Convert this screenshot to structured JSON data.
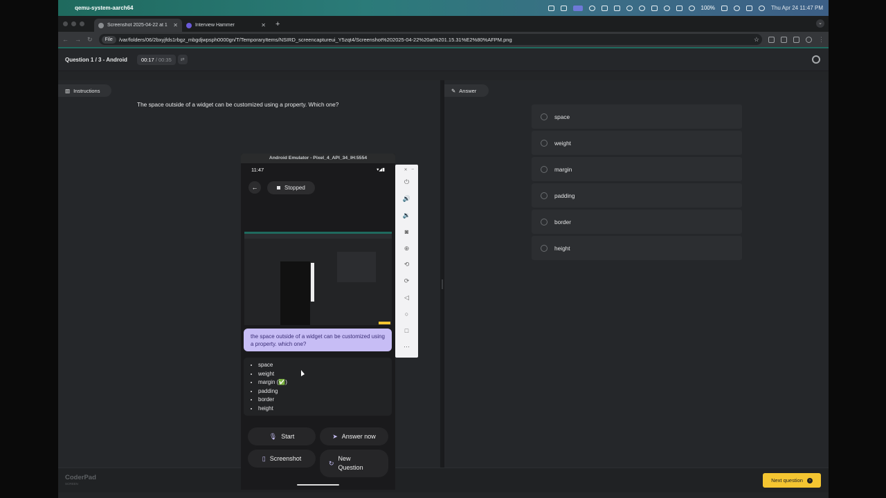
{
  "menubar": {
    "app_name": "qemu-system-aarch64",
    "battery": "100%",
    "clock": "Thu Apr 24  11:47 PM"
  },
  "browser": {
    "tabs": [
      {
        "title": "Screenshot 2025-04-22 at 1",
        "active": true
      },
      {
        "title": "Interview Hammer",
        "active": false
      }
    ],
    "url_chip": "File",
    "url": "/var/folders/06/2bxyjfds1rbgz_mbgdjwpsph0000gn/T/TemporaryItems/NSIRD_screencaptureui_Y5zqt4/Screenshot%202025-04-22%20at%201.15.31%E2%80%AFPM.png"
  },
  "coderpad": {
    "question_label": "Question 1 / 3 - Android",
    "timer_elapsed": "00:17",
    "timer_total": "/ 00:35",
    "instructions_label": "Instructions",
    "answer_label": "Answer",
    "question_text": "The space outside of a widget can be customized using a property. Which one?",
    "options": [
      "space",
      "weight",
      "margin",
      "padding",
      "border",
      "height"
    ],
    "brand": "CoderPad",
    "brand_sub": "SCREEN",
    "next_button": "Next question"
  },
  "emulator": {
    "window_title": "Android Emulator - Pixel_4_API_34_IH:5554",
    "time": "11:47",
    "status": "Stopped",
    "prompt": "the space outside of a widget can be customized using a property. which one?",
    "answers": [
      "space",
      "weight",
      "margin (✅)",
      "padding",
      "border",
      "height"
    ],
    "buttons": {
      "start": "Start",
      "answer_now": "Answer now",
      "screenshot": "Screenshot",
      "new_question": "New Question"
    }
  }
}
